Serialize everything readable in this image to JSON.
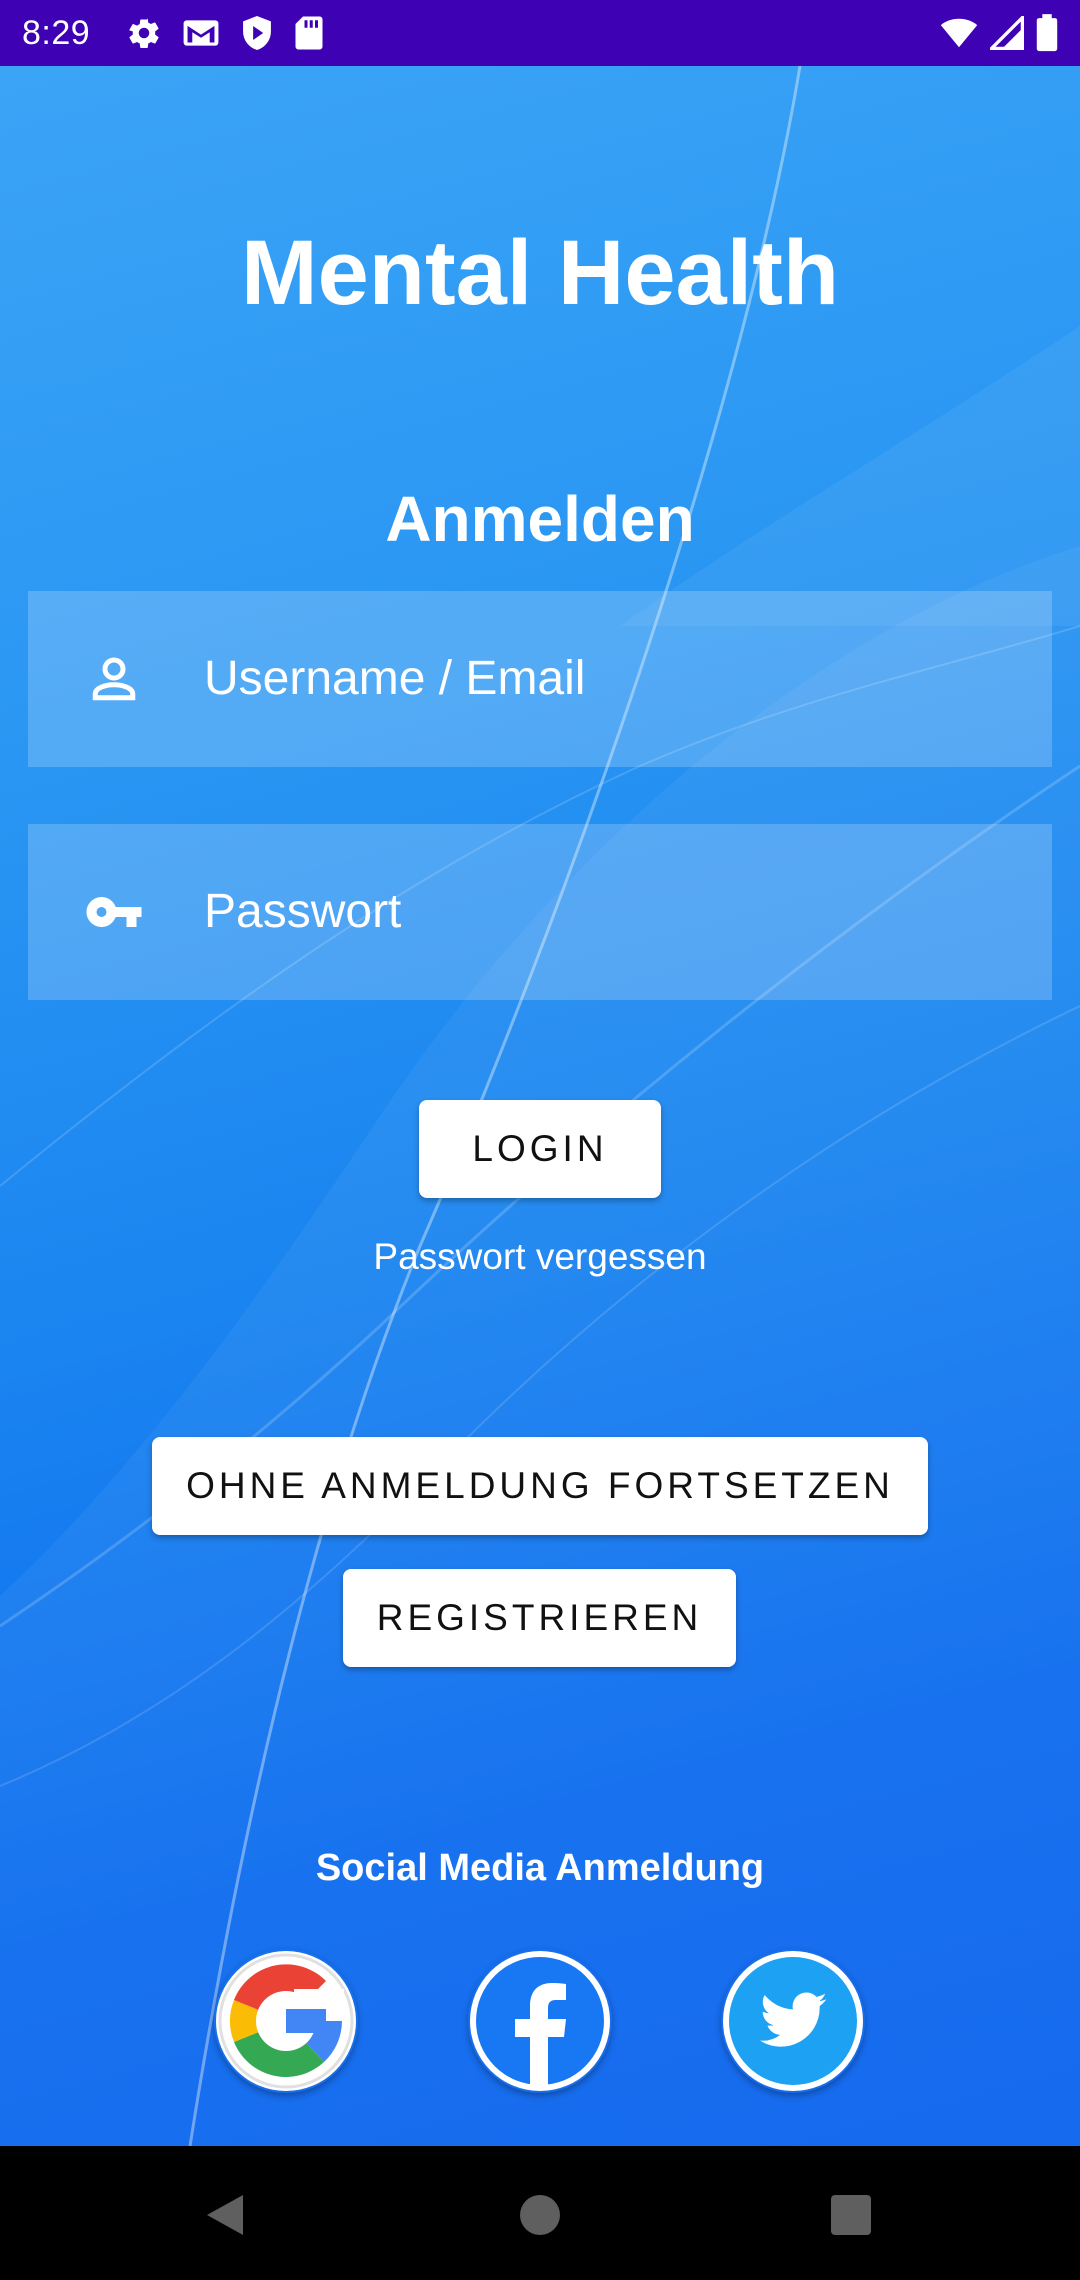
{
  "status_bar": {
    "time": "8:29",
    "left_icons": [
      "gear-icon",
      "gmail-icon",
      "play-protect-icon",
      "sd-card-icon"
    ],
    "right_icons": [
      "wifi-icon",
      "cell-signal-icon",
      "battery-icon"
    ]
  },
  "app": {
    "title": "Mental Health"
  },
  "login": {
    "heading": "Anmelden",
    "username_placeholder": "Username / Email",
    "password_placeholder": "Passwort",
    "login_button": "LOGIN",
    "forgot_password": "Passwort vergessen",
    "continue_without_login": "OHNE ANMELDUNG FORTSETZEN",
    "register_button": "REGISTRIEREN"
  },
  "social": {
    "heading": "Social Media Anmeldung",
    "providers": [
      "google-icon",
      "facebook-icon",
      "twitter-icon"
    ],
    "colors": {
      "facebook": "#1877f2",
      "twitter": "#1da1f2"
    }
  },
  "nav": {
    "buttons": [
      "back-icon",
      "home-icon",
      "recents-icon"
    ]
  },
  "colors": {
    "status_bar": "#3f01b4",
    "background_top": "#3ba4f6",
    "background_bottom": "#0a62ee"
  }
}
